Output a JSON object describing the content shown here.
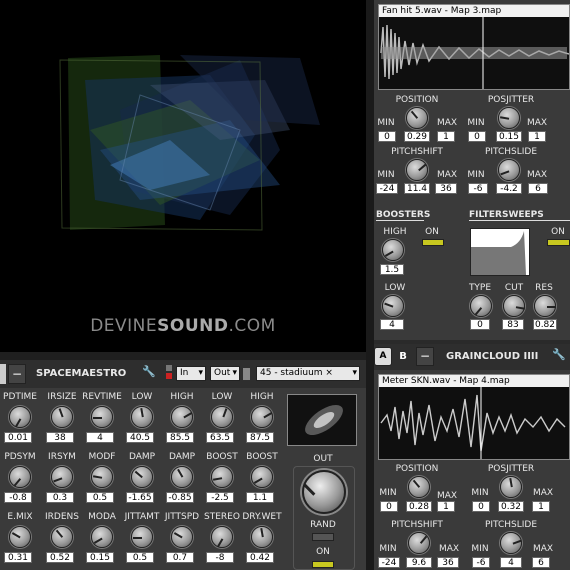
{
  "brand": {
    "prefix": "DEVINE",
    "main": "SOUND",
    "suffix": ".COM"
  },
  "grain1": {
    "file_title": "Fan hit 5.wav - Map 3.map",
    "position": {
      "label": "POSITION",
      "min_label": "MIN",
      "max_label": "MAX",
      "min": "0",
      "value": "0.29",
      "max": "1"
    },
    "posjitter": {
      "label": "POSJITTER",
      "min_label": "MIN",
      "max_label": "MAX",
      "min": "0",
      "value": "0.15",
      "max": "1"
    },
    "pitchshift": {
      "label": "PITCHSHIFT",
      "min_label": "MIN",
      "max_label": "MAX",
      "min": "-24",
      "value": "11.4",
      "max": "36"
    },
    "pitchslide": {
      "label": "PITCHSLIDE",
      "min_label": "MIN",
      "max_label": "MAX",
      "min": "-6",
      "value": "-4.2",
      "max": "6"
    },
    "boosters": {
      "label": "BOOSTERS",
      "high_label": "HIGH",
      "on_label": "ON",
      "high_value": "1.5",
      "low_label": "LOW",
      "low_value": "4"
    },
    "filtersweeps": {
      "label": "FILTERSWEEPS",
      "on_label": "ON",
      "type_label": "TYPE",
      "cut_label": "CUT",
      "res_label": "RES",
      "type_value": "0",
      "cut_value": "83",
      "res_value": "0.82"
    }
  },
  "grain2": {
    "btn_a": "A",
    "btn_b": "B",
    "btn_minus": "−",
    "title": "GRAINCLOUD IIII",
    "file_title": "Meter SKN.wav - Map 4.map",
    "position": {
      "label": "POSITION",
      "min_label": "MIN",
      "max_label": "MAX",
      "min": "0",
      "value": "0.28",
      "max": "1"
    },
    "posjitter": {
      "label": "POSJITTER",
      "min_label": "MIN",
      "max_label": "MAX",
      "min": "0",
      "value": "0.32",
      "max": "1"
    },
    "pitchshift": {
      "label": "PITCHSHIFT",
      "min_label": "MIN",
      "max_label": "MAX",
      "min": "-24",
      "value": "9.6",
      "max": "36"
    },
    "pitchslide": {
      "label": "PITCHSLIDE",
      "min_label": "MIN",
      "max_label": "MAX",
      "min": "-6",
      "value": "4",
      "max": "6"
    }
  },
  "reverb": {
    "btn_minus": "−",
    "title": "SPACEMAESTRO",
    "in_select": "In",
    "out_select": "Out",
    "preset_select": "45 - stadiuum ×",
    "row1": [
      {
        "label": "PDTIME",
        "value": "0.01"
      },
      {
        "label": "IRSIZE",
        "value": "38"
      },
      {
        "label": "REVTIME",
        "value": "4"
      },
      {
        "label": "LOW",
        "value": "40.5"
      },
      {
        "label": "HIGH",
        "value": "85.5"
      },
      {
        "label": "LOW",
        "value": "63.5"
      },
      {
        "label": "HIGH",
        "value": "87.5"
      }
    ],
    "row2": [
      {
        "label": "PDSYM",
        "value": "-0.8"
      },
      {
        "label": "IRSYM",
        "value": "0.3"
      },
      {
        "label": "MODF",
        "value": "0.5"
      },
      {
        "label": "DAMP",
        "value": "-1.65"
      },
      {
        "label": "DAMP",
        "value": "-0.85"
      },
      {
        "label": "BOOST",
        "value": "-2.5"
      },
      {
        "label": "BOOST",
        "value": "1.1"
      }
    ],
    "row3": [
      {
        "label": "E.MIX",
        "value": "0.31"
      },
      {
        "label": "IRDENS",
        "value": "0.52"
      },
      {
        "label": "MODA",
        "value": "0.15"
      },
      {
        "label": "JITTAMT",
        "value": "0.5"
      },
      {
        "label": "JITTSPD",
        "value": "0.7"
      },
      {
        "label": "STEREO",
        "value": "-8"
      },
      {
        "label": "DRY.WET",
        "value": "0.42"
      }
    ],
    "out_label": "OUT",
    "rand_label": "RAND",
    "on_label": "ON"
  },
  "colors": {
    "accent": "#c8c820",
    "panel": "#3a3a3a",
    "viz_bg": "#000000"
  }
}
